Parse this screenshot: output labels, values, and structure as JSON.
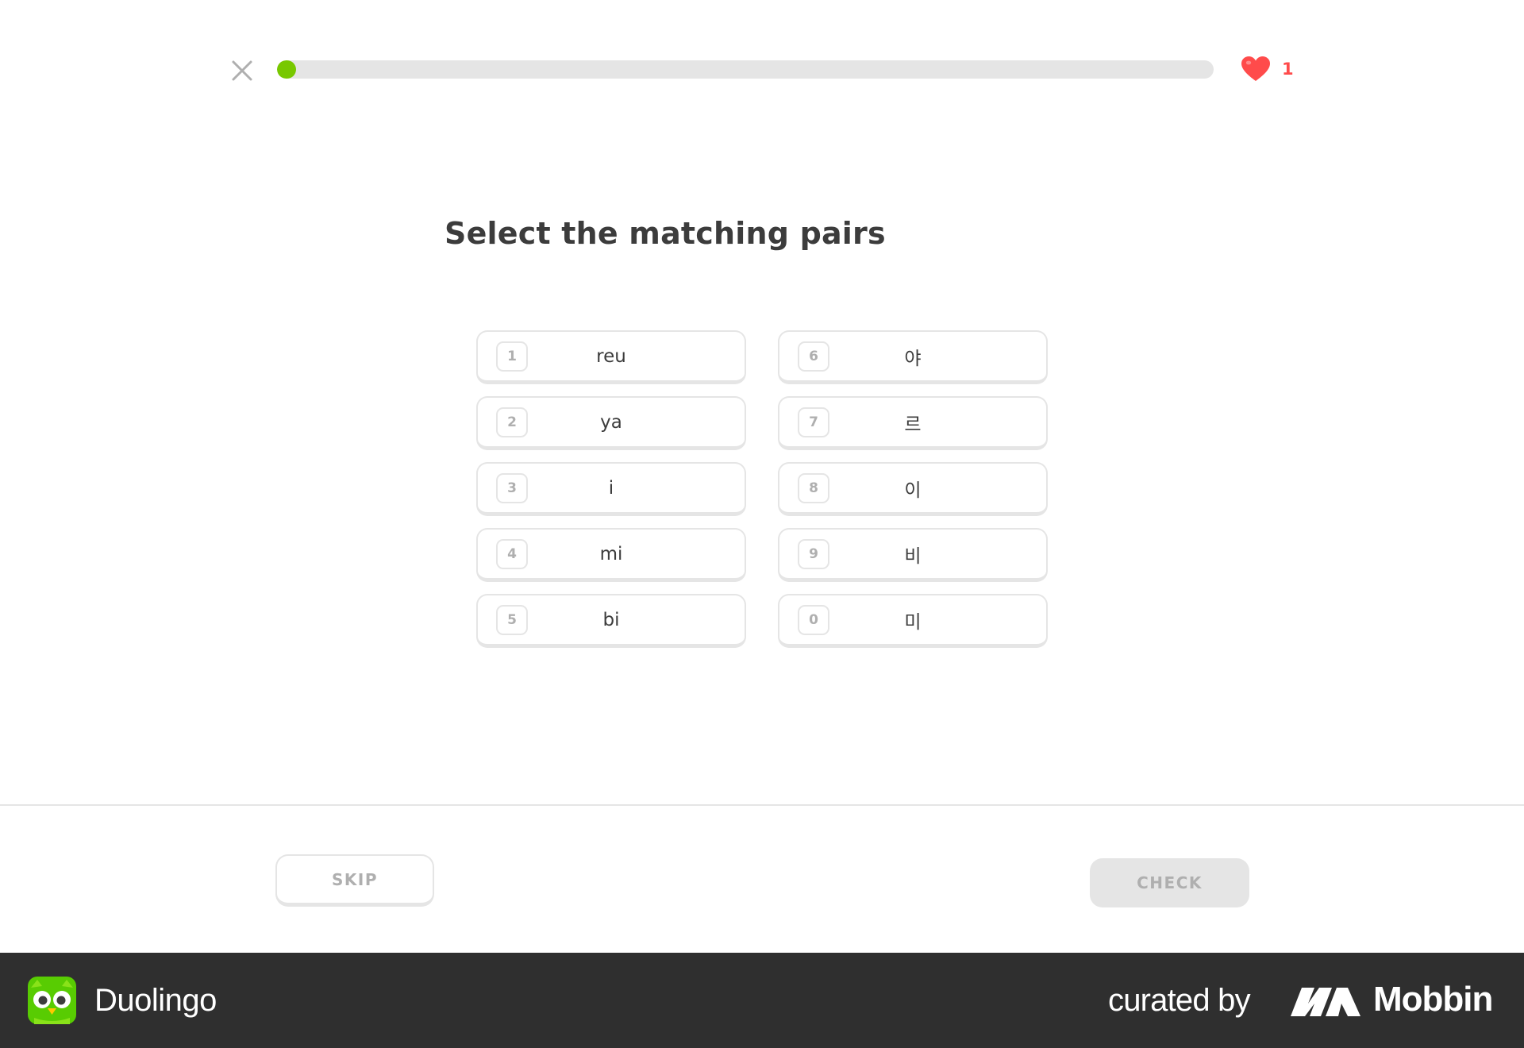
{
  "header": {
    "close_icon": "close-icon",
    "progress_fraction": 0.02,
    "progress_color": "#78c800",
    "hearts_icon": "heart-icon",
    "hearts_count": "1"
  },
  "challenge": {
    "prompt": "Select the matching pairs",
    "left_column": [
      {
        "key": "1",
        "text": "reu"
      },
      {
        "key": "2",
        "text": "ya"
      },
      {
        "key": "3",
        "text": "i"
      },
      {
        "key": "4",
        "text": "mi"
      },
      {
        "key": "5",
        "text": "bi"
      }
    ],
    "right_column": [
      {
        "key": "6",
        "text": "야"
      },
      {
        "key": "7",
        "text": "르"
      },
      {
        "key": "8",
        "text": "이"
      },
      {
        "key": "9",
        "text": "비"
      },
      {
        "key": "0",
        "text": "미"
      }
    ]
  },
  "footer": {
    "skip_label": "SKIP",
    "check_label": "CHECK"
  },
  "brand_bar": {
    "app_icon": "duolingo-owl-icon",
    "app_name": "Duolingo",
    "curated_label": "curated by",
    "curator_icon": "mobbin-logo-icon",
    "curator_name": "Mobbin"
  }
}
